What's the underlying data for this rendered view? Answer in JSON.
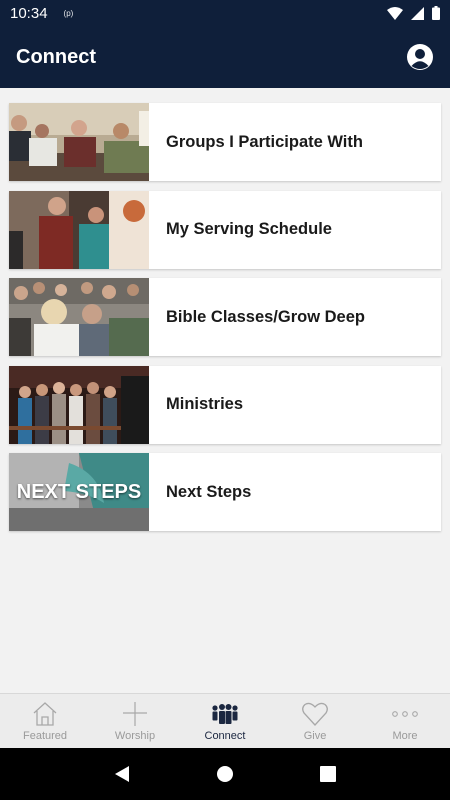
{
  "status_bar": {
    "time": "10:34",
    "indicator": "(p)"
  },
  "app_bar": {
    "title": "Connect",
    "profile_icon": "profile-icon"
  },
  "cards": [
    {
      "label": "Groups I Participate With",
      "thumb": "group-photo"
    },
    {
      "label": "My Serving Schedule",
      "thumb": "serving-photo"
    },
    {
      "label": "Bible Classes/Grow Deep",
      "thumb": "class-photo"
    },
    {
      "label": "Ministries",
      "thumb": "ministries-photo"
    },
    {
      "label": "Next Steps",
      "thumb": "next-steps-graphic",
      "thumb_text": "NEXT STEPS"
    }
  ],
  "tabs": [
    {
      "label": "Featured",
      "icon": "home-icon",
      "active": false
    },
    {
      "label": "Worship",
      "icon": "cross-icon",
      "active": false
    },
    {
      "label": "Connect",
      "icon": "people-icon",
      "active": true
    },
    {
      "label": "Give",
      "icon": "heart-icon",
      "active": false
    },
    {
      "label": "More",
      "icon": "ellipsis-icon",
      "active": false
    }
  ],
  "colors": {
    "header": "#0f1f3a",
    "active_tab": "#1b2740",
    "inactive_tab": "#9a9a9a"
  }
}
